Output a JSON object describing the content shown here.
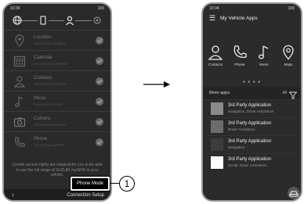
{
  "left_screen": {
    "status": {
      "time": "10:34",
      "right": "100"
    },
    "steps": [
      {
        "icon": "globe-icon"
      },
      {
        "icon": "phone-icon"
      },
      {
        "icon": "user-icon"
      },
      {
        "icon": "settings-icon"
      }
    ],
    "permissions": [
      {
        "title": "Location",
        "subtitle": "Access your location",
        "icon": "location-pin-icon"
      },
      {
        "title": "Calendar",
        "subtitle": "Access your calendar",
        "icon": "calendar-icon"
      },
      {
        "title": "Contacts",
        "subtitle": "Access your contacts",
        "icon": "contacts-icon"
      },
      {
        "title": "Music",
        "subtitle": "Access your music",
        "icon": "music-icon"
      },
      {
        "title": "Camera",
        "subtitle": "Access your camera",
        "icon": "camera-icon"
      },
      {
        "title": "Phone",
        "subtitle": "Access your phone",
        "icon": "phone-handset-icon"
      }
    ],
    "info_text": "Certain access rights are required for you to be able to use the full range of SUZUKI mySPIN in your vehicle.",
    "phone_mode_label": "Phone Mode",
    "connection_setup_label": "Connection Setup",
    "back_label": "‹"
  },
  "callout": {
    "number": "1"
  },
  "right_screen": {
    "status": {
      "time": "10:34",
      "right": "100"
    },
    "title": "My Vehicle Apps",
    "apps": [
      {
        "label": "Contacts",
        "icon": "contacts-icon"
      },
      {
        "label": "Phone",
        "icon": "phone-handset-icon"
      },
      {
        "label": "Music",
        "icon": "music-icon"
      },
      {
        "label": "Maps",
        "icon": "location-pin-icon"
      }
    ],
    "pager": "● ● ● ●",
    "more_apps_label": "More apps",
    "all_label": "All",
    "more_apps": [
      {
        "name": "3rd Party Application",
        "category": "Navigation, Driver Assistance",
        "color": "#8a8a8a"
      },
      {
        "name": "3rd Party Application",
        "category": "Driver Assistance",
        "color": "#6c6c6c"
      },
      {
        "name": "3rd Party Application",
        "category": "Navigation",
        "color": "#3c3c3c"
      },
      {
        "name": "3rd Party Application",
        "category": "Social, Driver Assistance",
        "color": "#ffffff"
      }
    ]
  }
}
